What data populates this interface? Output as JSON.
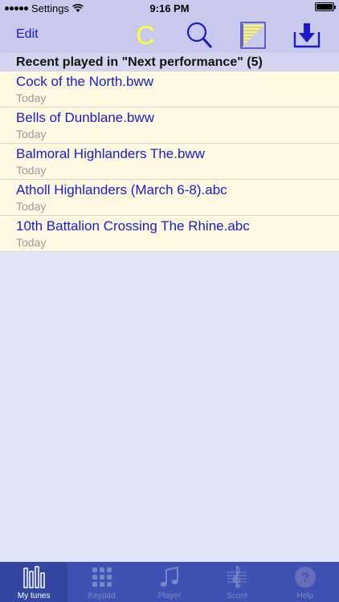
{
  "status": {
    "carrier": "Settings",
    "time": "9:16 PM"
  },
  "nav": {
    "edit_label": "Edit",
    "c_label": "C"
  },
  "section": {
    "header": "Recent played in \"Next performance\" (5)"
  },
  "tunes": [
    {
      "title": "Cock of the North.bww",
      "date": "Today"
    },
    {
      "title": "Bells of Dunblane.bww",
      "date": "Today"
    },
    {
      "title": "Balmoral Highlanders The.bww",
      "date": "Today"
    },
    {
      "title": "Atholl Highlanders (March 6-8).abc",
      "date": "Today"
    },
    {
      "title": "10th Battalion Crossing The Rhine.abc",
      "date": "Today"
    }
  ],
  "tabs": [
    {
      "label": "My tunes",
      "icon": "pipes-icon",
      "active": true
    },
    {
      "label": "Keypad",
      "icon": "keypad-icon",
      "active": false
    },
    {
      "label": "Player",
      "icon": "music-note-icon",
      "active": false
    },
    {
      "label": "Score",
      "icon": "treble-clef-icon",
      "active": false
    },
    {
      "label": "Help",
      "icon": "help-icon",
      "active": false
    }
  ],
  "colors": {
    "accent": "#1a1acc",
    "highlight": "#ffff33",
    "tab_bar": "#3f51b2",
    "row_bg": "#fff9e3"
  }
}
